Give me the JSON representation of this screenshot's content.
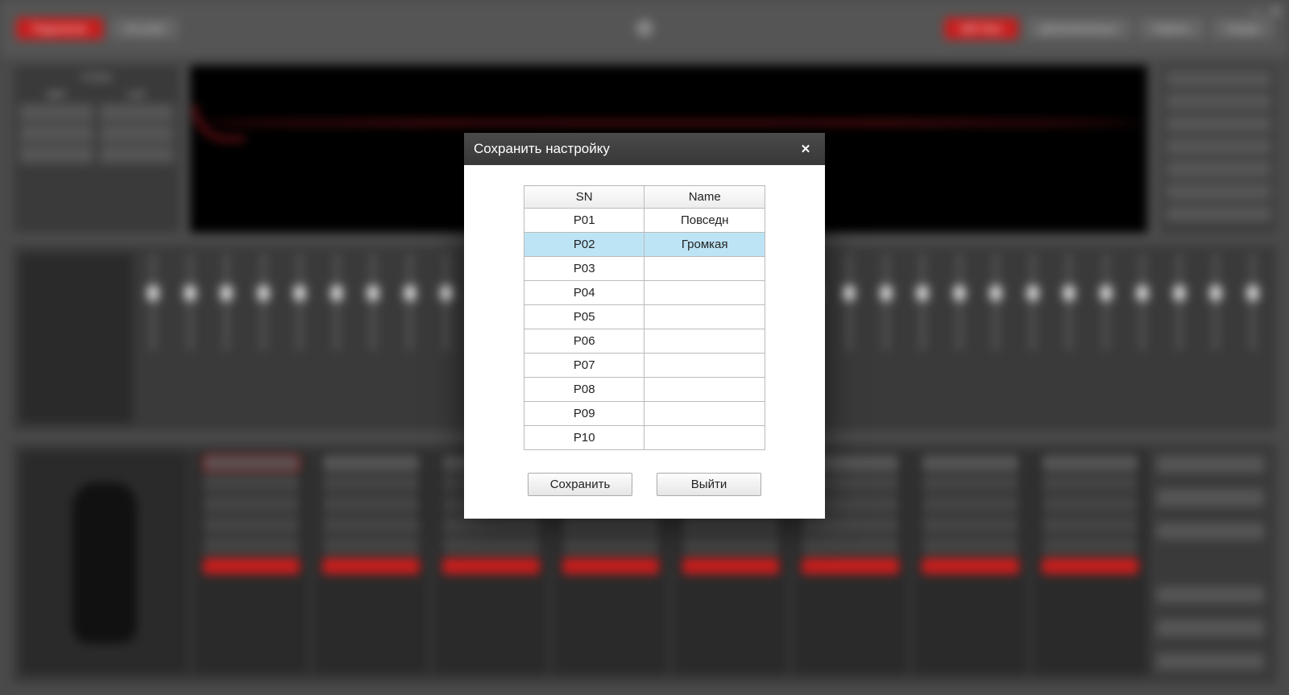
{
  "bg": {
    "connect": "Подключен",
    "level": "Hi Level",
    "warn": "WiFi Box",
    "menu1": "Дополнительно",
    "menu2": "Память",
    "menu3": "Опции",
    "xover": {
      "title": "X-Over",
      "hpf": "HPF",
      "lpf": "LPF"
    }
  },
  "modal": {
    "title": "Сохранить настройку",
    "columns": {
      "sn": "SN",
      "name": "Name"
    },
    "rows": [
      {
        "sn": "P01",
        "name": "Повседн",
        "selected": false
      },
      {
        "sn": "P02",
        "name": "Громкая",
        "selected": true
      },
      {
        "sn": "P03",
        "name": "",
        "selected": false
      },
      {
        "sn": "P04",
        "name": "",
        "selected": false
      },
      {
        "sn": "P05",
        "name": "",
        "selected": false
      },
      {
        "sn": "P06",
        "name": "",
        "selected": false
      },
      {
        "sn": "P07",
        "name": "",
        "selected": false
      },
      {
        "sn": "P08",
        "name": "",
        "selected": false
      },
      {
        "sn": "P09",
        "name": "",
        "selected": false
      },
      {
        "sn": "P10",
        "name": "",
        "selected": false
      }
    ],
    "buttons": {
      "save": "Сохранить",
      "exit": "Выйти"
    }
  }
}
